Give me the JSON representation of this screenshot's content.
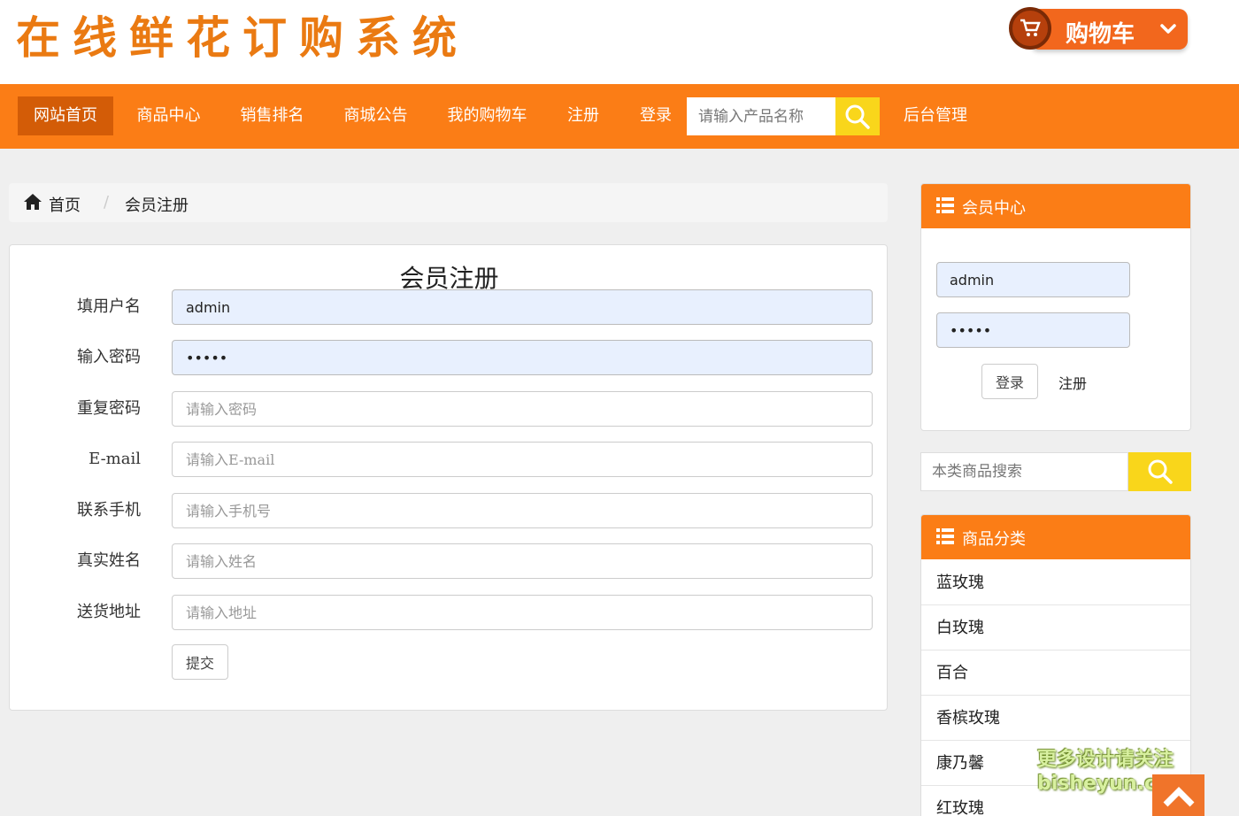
{
  "header": {
    "logo": "在线鲜花订购系统",
    "cart_label": "购物车"
  },
  "nav": {
    "items": [
      {
        "label": "网站首页",
        "active": true
      },
      {
        "label": "商品中心"
      },
      {
        "label": "销售排名"
      },
      {
        "label": "商城公告"
      },
      {
        "label": "我的购物车"
      },
      {
        "label": "注册"
      },
      {
        "label": "登录"
      }
    ],
    "search_placeholder": "请输入产品名称",
    "admin_label": "后台管理"
  },
  "breadcrumb": {
    "home": "首页",
    "separator": "/",
    "current": "会员注册"
  },
  "form": {
    "title": "会员注册",
    "fields": [
      {
        "label": "填用户名",
        "value": "admin",
        "placeholder": ""
      },
      {
        "label": "输入密码",
        "value": "•••••",
        "placeholder": ""
      },
      {
        "label": "重复密码",
        "value": "",
        "placeholder": "请输入密码"
      },
      {
        "label": "E-mail",
        "value": "",
        "placeholder": "请输入E-mail"
      },
      {
        "label": "联系手机",
        "value": "",
        "placeholder": "请输入手机号"
      },
      {
        "label": "真实姓名",
        "value": "",
        "placeholder": "请输入姓名"
      },
      {
        "label": "送货地址",
        "value": "",
        "placeholder": "请输入地址"
      }
    ],
    "submit_label": "提交"
  },
  "sidebar": {
    "member": {
      "title": "会员中心",
      "username_value": "admin",
      "password_value": "•••••",
      "login_label": "登录",
      "register_label": "注册"
    },
    "search_placeholder": "本类商品搜索",
    "categories": {
      "title": "商品分类",
      "items": [
        "蓝玫瑰",
        "白玫瑰",
        "百合",
        "香槟玫瑰",
        "康乃馨",
        "红玫瑰"
      ]
    }
  },
  "watermark": {
    "line1": "更多设计请关注",
    "line2": "bisheyun.com"
  },
  "colors": {
    "nav": "#fb7d16",
    "nav_active": "#d35c07",
    "logo": "#ea7a12",
    "search_button": "#f9d61b"
  }
}
